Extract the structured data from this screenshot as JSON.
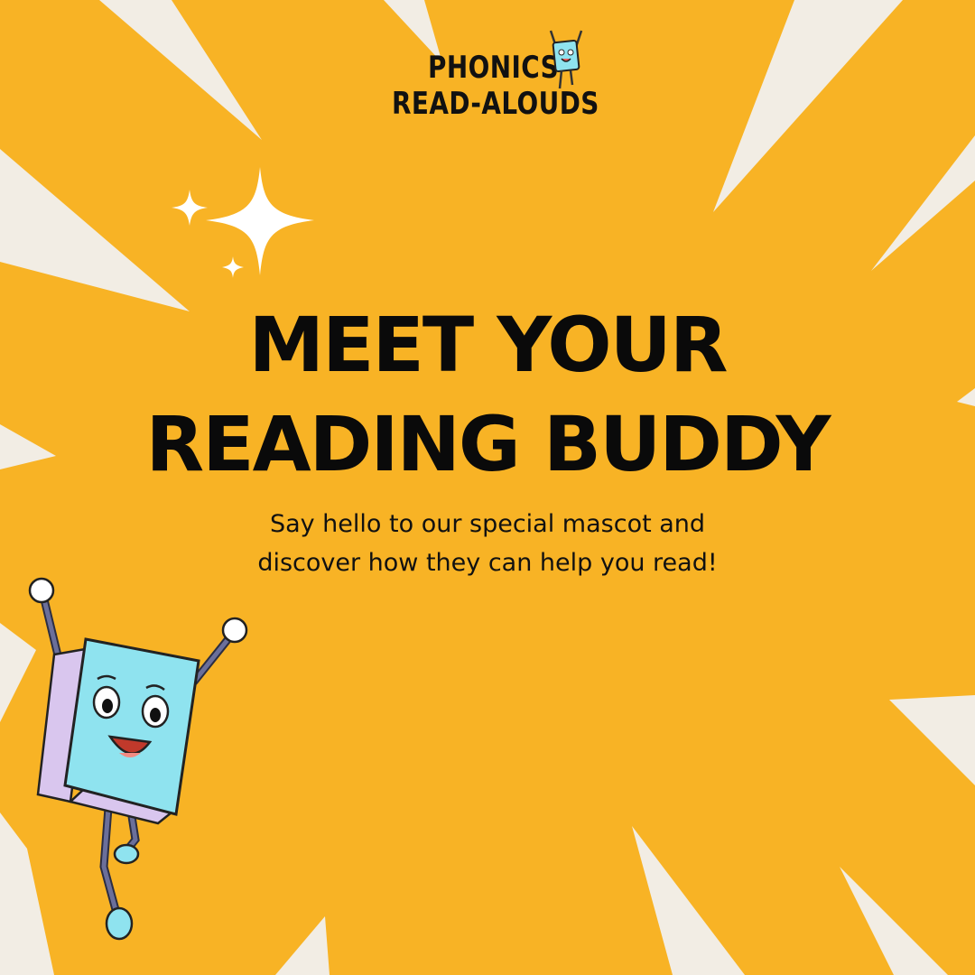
{
  "brand": {
    "line1": "PHONICS",
    "line2": "READ-ALOUDS"
  },
  "headline": {
    "line1": "MEET YOUR",
    "line2": "READING BUDDY"
  },
  "subtitle": {
    "line1": "Say hello to our special mascot and",
    "line2": "discover how they can help you read!"
  },
  "colors": {
    "background": "#f8b325",
    "rays": "#f2ede4",
    "text": "#0a0a0a",
    "mascot_book": "#8fe3ef"
  },
  "icons": {
    "sparkles": "sparkles-icon",
    "mascot": "book-mascot-icon"
  }
}
